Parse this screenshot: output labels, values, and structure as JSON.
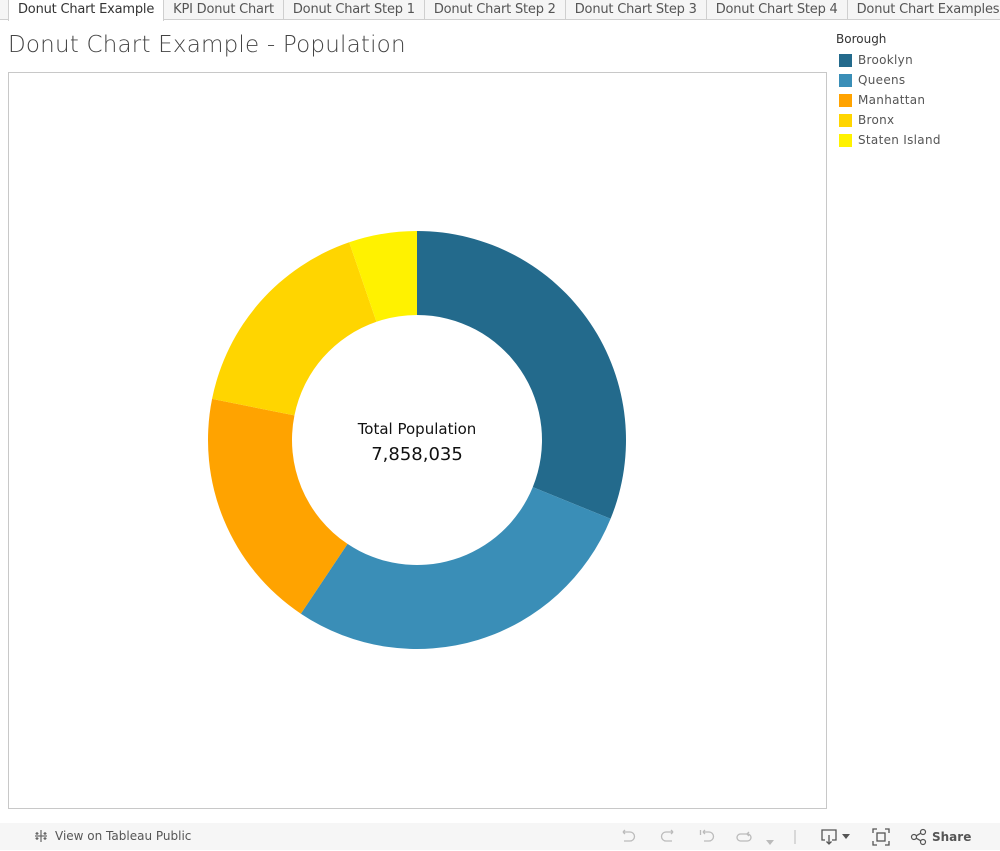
{
  "tabs": [
    {
      "label": "Donut Chart Example",
      "active": true
    },
    {
      "label": "KPI Donut Chart",
      "active": false
    },
    {
      "label": "Donut Chart Step 1",
      "active": false
    },
    {
      "label": "Donut Chart Step 2",
      "active": false
    },
    {
      "label": "Donut Chart Step 3",
      "active": false
    },
    {
      "label": "Donut Chart Step 4",
      "active": false
    },
    {
      "label": "Donut Chart Examples 2",
      "active": false
    }
  ],
  "page_title": "Donut Chart Example - Population",
  "legend": {
    "title": "Borough",
    "items": [
      {
        "label": "Brooklyn",
        "color": "#236a8c"
      },
      {
        "label": "Queens",
        "color": "#3a8eb7"
      },
      {
        "label": "Manhattan",
        "color": "#ffa300"
      },
      {
        "label": "Bronx",
        "color": "#ffd500"
      },
      {
        "label": "Staten Island",
        "color": "#fff200"
      }
    ]
  },
  "chart_data": {
    "type": "pie",
    "variant": "donut",
    "title": "Donut Chart Example - Population",
    "legend_title": "Borough",
    "legend_position": "right",
    "categories": [
      "Brooklyn",
      "Queens",
      "Manhattan",
      "Bronx",
      "Staten Island"
    ],
    "values": [
      2448000,
      2218000,
      1475000,
      1304000,
      413000
    ],
    "colors": [
      "#236a8c",
      "#3a8eb7",
      "#ffa300",
      "#ffd500",
      "#fff200"
    ],
    "start": "top",
    "direction": "clockwise",
    "center_label": "Total Population",
    "center_value": "7,858,035"
  },
  "footer": {
    "view_label": "View on Tableau Public",
    "share_label": "Share"
  }
}
